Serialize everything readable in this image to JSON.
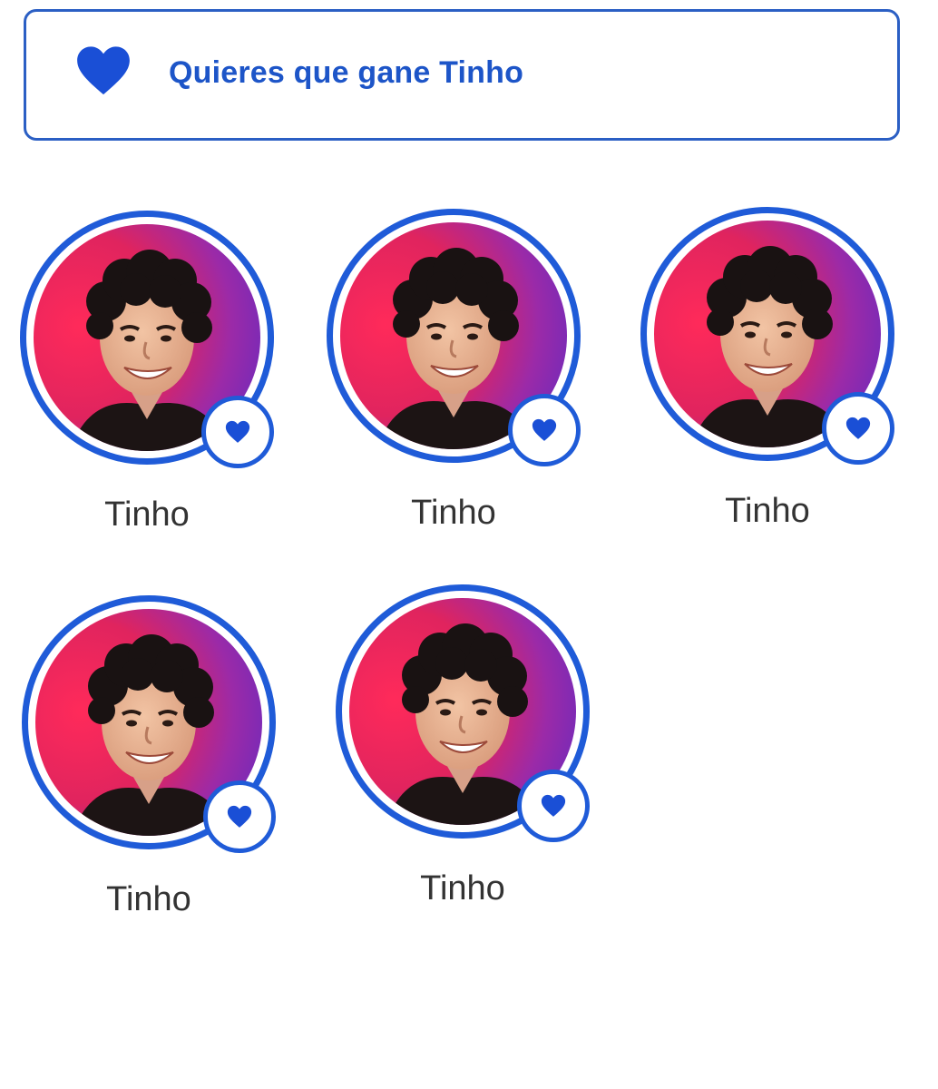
{
  "header": {
    "vote_prompt": "Quieres que gane Tinho",
    "icon": "heart-icon",
    "accent_color": "#1f5bd8"
  },
  "contestants": [
    {
      "name": "Tinho",
      "icon": "heart-icon"
    },
    {
      "name": "Tinho",
      "icon": "heart-icon"
    },
    {
      "name": "Tinho",
      "icon": "heart-icon"
    },
    {
      "name": "Tinho",
      "icon": "heart-icon"
    },
    {
      "name": "Tinho",
      "icon": "heart-icon"
    }
  ]
}
